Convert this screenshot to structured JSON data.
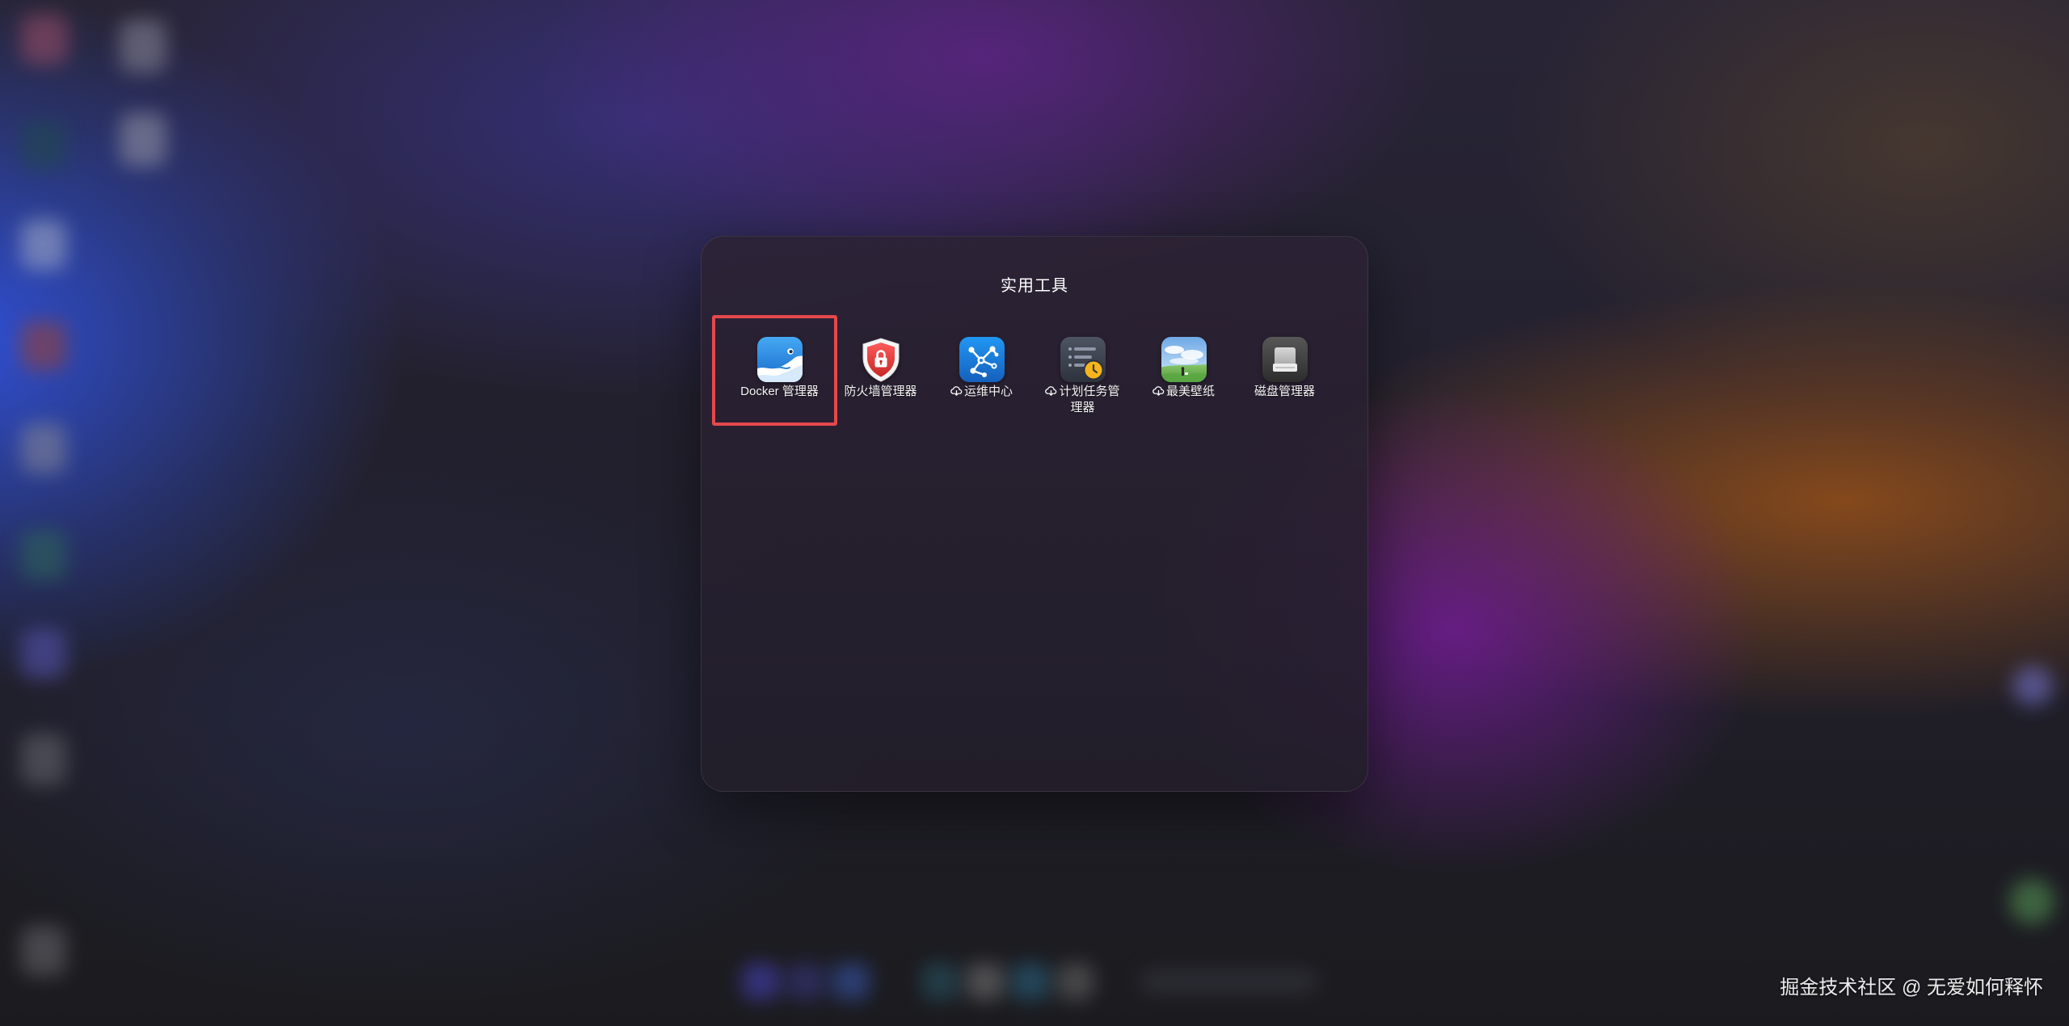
{
  "folder": {
    "title": "实用工具"
  },
  "apps": [
    {
      "label": "Docker 管理器",
      "icon": "docker-whale-icon",
      "cloud_download": false,
      "highlighted": true
    },
    {
      "label": "防火墙管理器",
      "icon": "firewall-shield-lock-icon",
      "cloud_download": false,
      "highlighted": false
    },
    {
      "label": "运维中心",
      "icon": "network-nodes-icon",
      "cloud_download": true,
      "highlighted": false
    },
    {
      "label": "计划任务管理器",
      "icon": "task-list-clock-icon",
      "cloud_download": true,
      "highlighted": false
    },
    {
      "label": "最美壁纸",
      "icon": "landscape-wallpaper-icon",
      "cloud_download": true,
      "highlighted": false
    },
    {
      "label": "磁盘管理器",
      "icon": "hard-disk-icon",
      "cloud_download": false,
      "highlighted": false
    }
  ],
  "cloud_icon": "cloud-download-icon",
  "watermark": "掘金技术社区 @ 无爱如何释怀",
  "colors": {
    "highlight_border": "#e5484d",
    "panel_background": "#2a2234",
    "label_text": "#f4f4f4"
  }
}
